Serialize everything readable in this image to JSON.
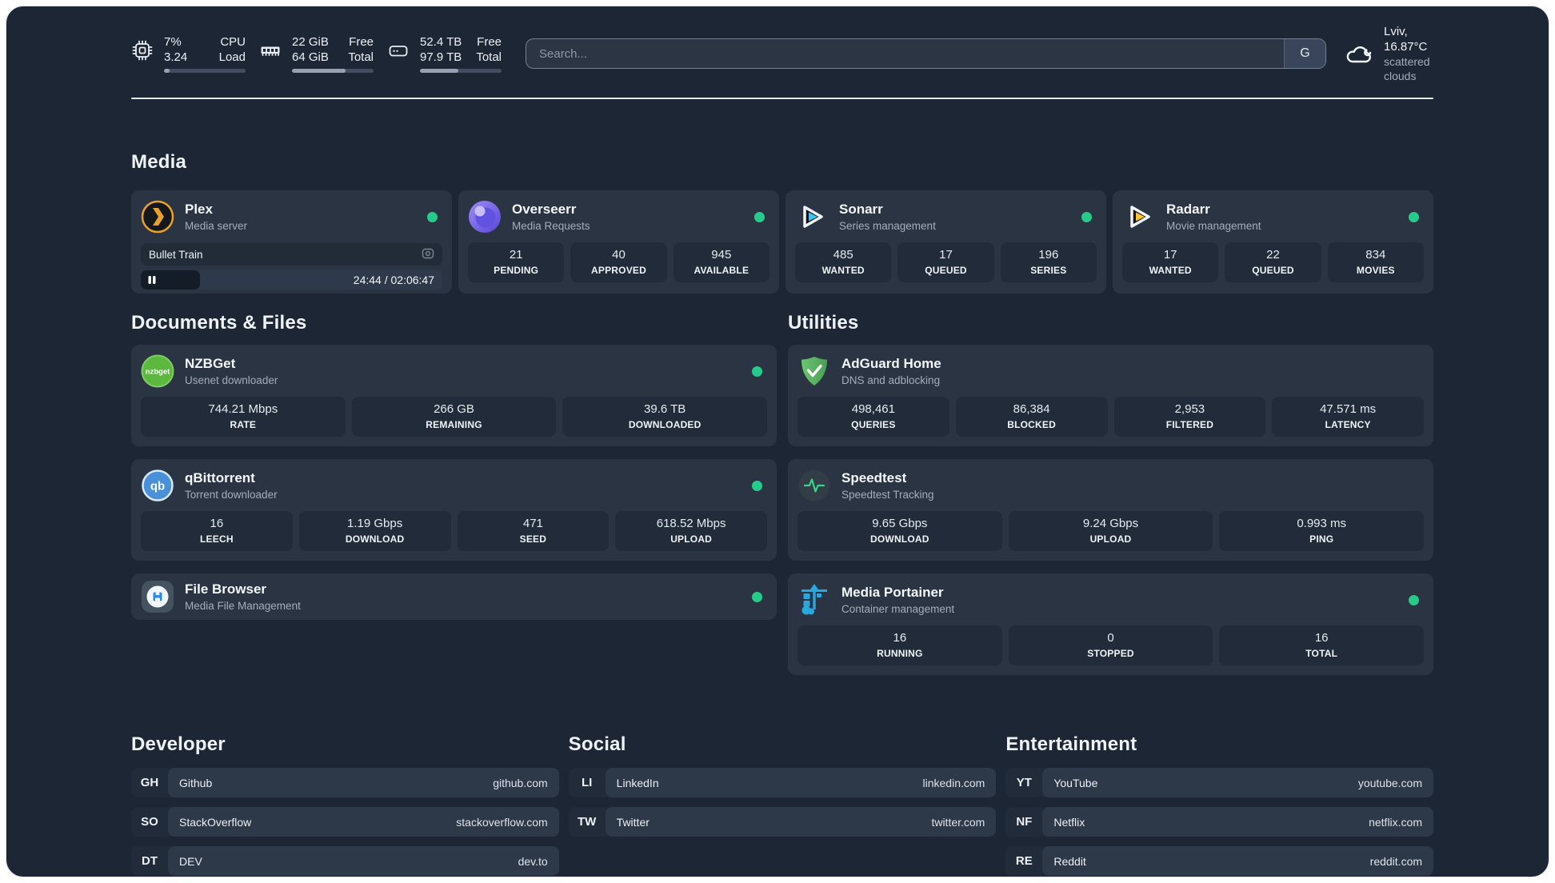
{
  "palette": {
    "background": "#1d2634",
    "card": "#2a3443",
    "tile": "#212b39",
    "status_online": "#26cb8c",
    "divider": "#e8ebee",
    "plex_accent": "#e8a22b",
    "sonarr_accent": "#38c6f4",
    "radarr_accent": "#fdc330",
    "adguard_accent": "#59b661",
    "portainer_accent": "#29a8e0"
  },
  "header": {
    "metrics": [
      {
        "icon": "cpu-icon",
        "value_top": "7%",
        "value_bottom": "3.24",
        "label_top": "CPU",
        "label_bottom": "Load",
        "progress_pct": 7
      },
      {
        "icon": "memory-icon",
        "value_top": "22 GiB",
        "value_bottom": "64 GiB",
        "label_top": "Free",
        "label_bottom": "Total",
        "progress_pct": 66
      },
      {
        "icon": "storage-icon",
        "value_top": "52.4 TB",
        "value_bottom": "97.9 TB",
        "label_top": "Free",
        "label_bottom": "Total",
        "progress_pct": 47
      }
    ],
    "search": {
      "placeholder": "Search...",
      "provider_button": "G"
    },
    "weather": {
      "location_temp": "Lviv, 16.87°C",
      "condition": "scattered clouds"
    }
  },
  "groups": {
    "media": {
      "title": "Media",
      "services": [
        {
          "name": "Plex",
          "description": "Media server",
          "online": true,
          "now_playing": {
            "title": "Bullet Train",
            "time": "24:44 / 02:06:47",
            "progress_pct": 19.5
          }
        },
        {
          "name": "Overseerr",
          "description": "Media Requests",
          "online": true,
          "stats": [
            {
              "value": "21",
              "label": "PENDING"
            },
            {
              "value": "40",
              "label": "APPROVED"
            },
            {
              "value": "945",
              "label": "AVAILABLE"
            }
          ]
        },
        {
          "name": "Sonarr",
          "description": "Series management",
          "online": true,
          "stats": [
            {
              "value": "485",
              "label": "WANTED"
            },
            {
              "value": "17",
              "label": "QUEUED"
            },
            {
              "value": "196",
              "label": "SERIES"
            }
          ]
        },
        {
          "name": "Radarr",
          "description": "Movie management",
          "online": true,
          "stats": [
            {
              "value": "17",
              "label": "WANTED"
            },
            {
              "value": "22",
              "label": "QUEUED"
            },
            {
              "value": "834",
              "label": "MOVIES"
            }
          ]
        }
      ]
    },
    "documents": {
      "title": "Documents & Files",
      "services": [
        {
          "name": "NZBGet",
          "description": "Usenet downloader",
          "online": true,
          "stats": [
            {
              "value": "744.21 Mbps",
              "label": "RATE"
            },
            {
              "value": "266 GB",
              "label": "REMAINING"
            },
            {
              "value": "39.6 TB",
              "label": "DOWNLOADED"
            }
          ]
        },
        {
          "name": "qBittorrent",
          "description": "Torrent downloader",
          "online": true,
          "stats": [
            {
              "value": "16",
              "label": "LEECH"
            },
            {
              "value": "1.19 Gbps",
              "label": "DOWNLOAD"
            },
            {
              "value": "471",
              "label": "SEED"
            },
            {
              "value": "618.52 Mbps",
              "label": "UPLOAD"
            }
          ]
        },
        {
          "name": "File Browser",
          "description": "Media File Management",
          "online": true
        }
      ]
    },
    "utilities": {
      "title": "Utilities",
      "services": [
        {
          "name": "AdGuard Home",
          "description": "DNS and adblocking",
          "stats": [
            {
              "value": "498,461",
              "label": "QUERIES"
            },
            {
              "value": "86,384",
              "label": "BLOCKED"
            },
            {
              "value": "2,953",
              "label": "FILTERED"
            },
            {
              "value": "47.571 ms",
              "label": "LATENCY"
            }
          ]
        },
        {
          "name": "Speedtest",
          "description": "Speedtest Tracking",
          "stats": [
            {
              "value": "9.65 Gbps",
              "label": "DOWNLOAD"
            },
            {
              "value": "9.24 Gbps",
              "label": "UPLOAD"
            },
            {
              "value": "0.993 ms",
              "label": "PING"
            }
          ]
        },
        {
          "name": "Media Portainer",
          "description": "Container management",
          "online": true,
          "stats": [
            {
              "value": "16",
              "label": "RUNNING"
            },
            {
              "value": "0",
              "label": "STOPPED"
            },
            {
              "value": "16",
              "label": "TOTAL"
            }
          ]
        }
      ]
    }
  },
  "bookmarks": [
    {
      "title": "Developer",
      "links": [
        {
          "abbr": "GH",
          "name": "Github",
          "url": "github.com"
        },
        {
          "abbr": "SO",
          "name": "StackOverflow",
          "url": "stackoverflow.com"
        },
        {
          "abbr": "DT",
          "name": "DEV",
          "url": "dev.to"
        }
      ]
    },
    {
      "title": "Social",
      "links": [
        {
          "abbr": "LI",
          "name": "LinkedIn",
          "url": "linkedin.com"
        },
        {
          "abbr": "TW",
          "name": "Twitter",
          "url": "twitter.com"
        }
      ]
    },
    {
      "title": "Entertainment",
      "links": [
        {
          "abbr": "YT",
          "name": "YouTube",
          "url": "youtube.com"
        },
        {
          "abbr": "NF",
          "name": "Netflix",
          "url": "netflix.com"
        },
        {
          "abbr": "RE",
          "name": "Reddit",
          "url": "reddit.com"
        }
      ]
    }
  ]
}
